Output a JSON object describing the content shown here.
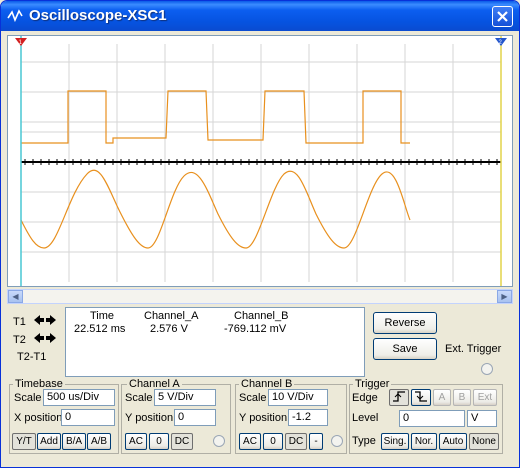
{
  "window": {
    "title": "Oscilloscope-XSC1",
    "icon": "oscilloscope-icon"
  },
  "readout": {
    "rows": [
      "T1",
      "T2",
      "T2-T1"
    ],
    "headers": {
      "time": "Time",
      "channel_a": "Channel_A",
      "channel_b": "Channel_B"
    },
    "t1": {
      "time": "22.512 ms",
      "channel_a": "2.576 V",
      "channel_b": "-769.112 mV"
    }
  },
  "buttons": {
    "reverse": "Reverse",
    "save": "Save",
    "ext_trigger": "Ext. Trigger"
  },
  "timebase": {
    "title": "Timebase",
    "scale_label": "Scale",
    "scale_value": "500 us/Div",
    "xpos_label": "X position",
    "xpos_value": "0",
    "modes": [
      "Y/T",
      "Add",
      "B/A",
      "A/B"
    ]
  },
  "channel_a": {
    "title": "Channel A",
    "scale_label": "Scale",
    "scale_value": "5  V/Div",
    "ypos_label": "Y position",
    "ypos_value": "0",
    "coupling": [
      "AC",
      "0",
      "DC"
    ]
  },
  "channel_b": {
    "title": "Channel B",
    "scale_label": "Scale",
    "scale_value": "10  V/Div",
    "ypos_label": "Y position",
    "ypos_value": "-1.2",
    "coupling": [
      "AC",
      "0",
      "DC",
      "-"
    ]
  },
  "trigger": {
    "title": "Trigger",
    "edge_label": "Edge",
    "edge_sources": [
      "A",
      "B",
      "Ext"
    ],
    "level_label": "Level",
    "level_value": "0",
    "level_unit": "V",
    "type_label": "Type",
    "types": [
      "Sing.",
      "Nor.",
      "Auto",
      "None"
    ]
  },
  "colors": {
    "trace_a": "#E8901E",
    "trace_b": "#E8901E",
    "cursor_t1": "#49C7D4",
    "cursor_t2": "#E2D34A"
  }
}
